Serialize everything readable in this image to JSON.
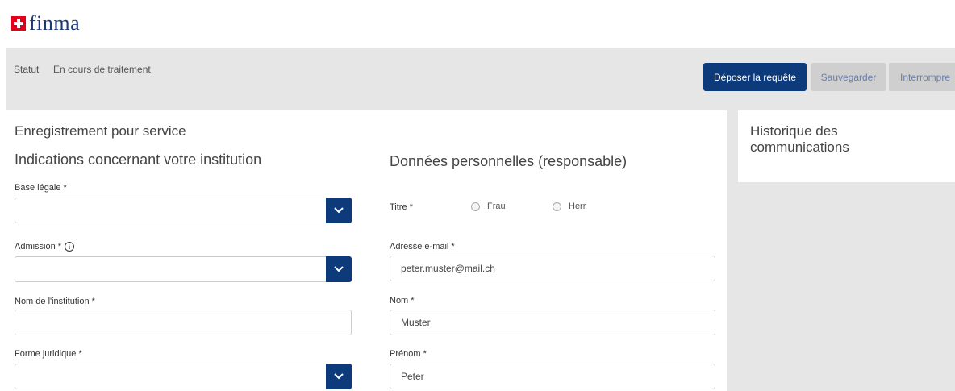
{
  "brand": {
    "name": "finma",
    "logo_color": "#1b3b78",
    "flag_color": "#e2001a"
  },
  "status": {
    "label": "Statut",
    "value": "En cours de traitement"
  },
  "actions": {
    "submit": "Déposer la requête",
    "save": "Sauvegarder",
    "interrupt": "Interrompre"
  },
  "page": {
    "title": "Enregistrement pour service"
  },
  "institution": {
    "heading": "Indications concernant votre institution",
    "base_legale": {
      "label": "Base légale *",
      "value": ""
    },
    "admission": {
      "label": "Admission *",
      "value": ""
    },
    "nom_institution": {
      "label": "Nom de l'institution *",
      "value": ""
    },
    "forme_juridique": {
      "label": "Forme juridique *",
      "value": ""
    }
  },
  "personal": {
    "heading": "Données personnelles (responsable)",
    "titre": {
      "label": "Titre *",
      "options": [
        "Frau",
        "Herr"
      ]
    },
    "email": {
      "label": "Adresse e-mail *",
      "value": "peter.muster@mail.ch"
    },
    "nom": {
      "label": "Nom *",
      "value": "Muster"
    },
    "prenom": {
      "label": "Prénom *",
      "value": "Peter"
    }
  },
  "sidebar": {
    "title": "Historique des communications"
  },
  "colors": {
    "primary": "#0c3a7a",
    "panel_bg": "#e6e6e6",
    "secondary_btn": "#cfcfcf"
  }
}
